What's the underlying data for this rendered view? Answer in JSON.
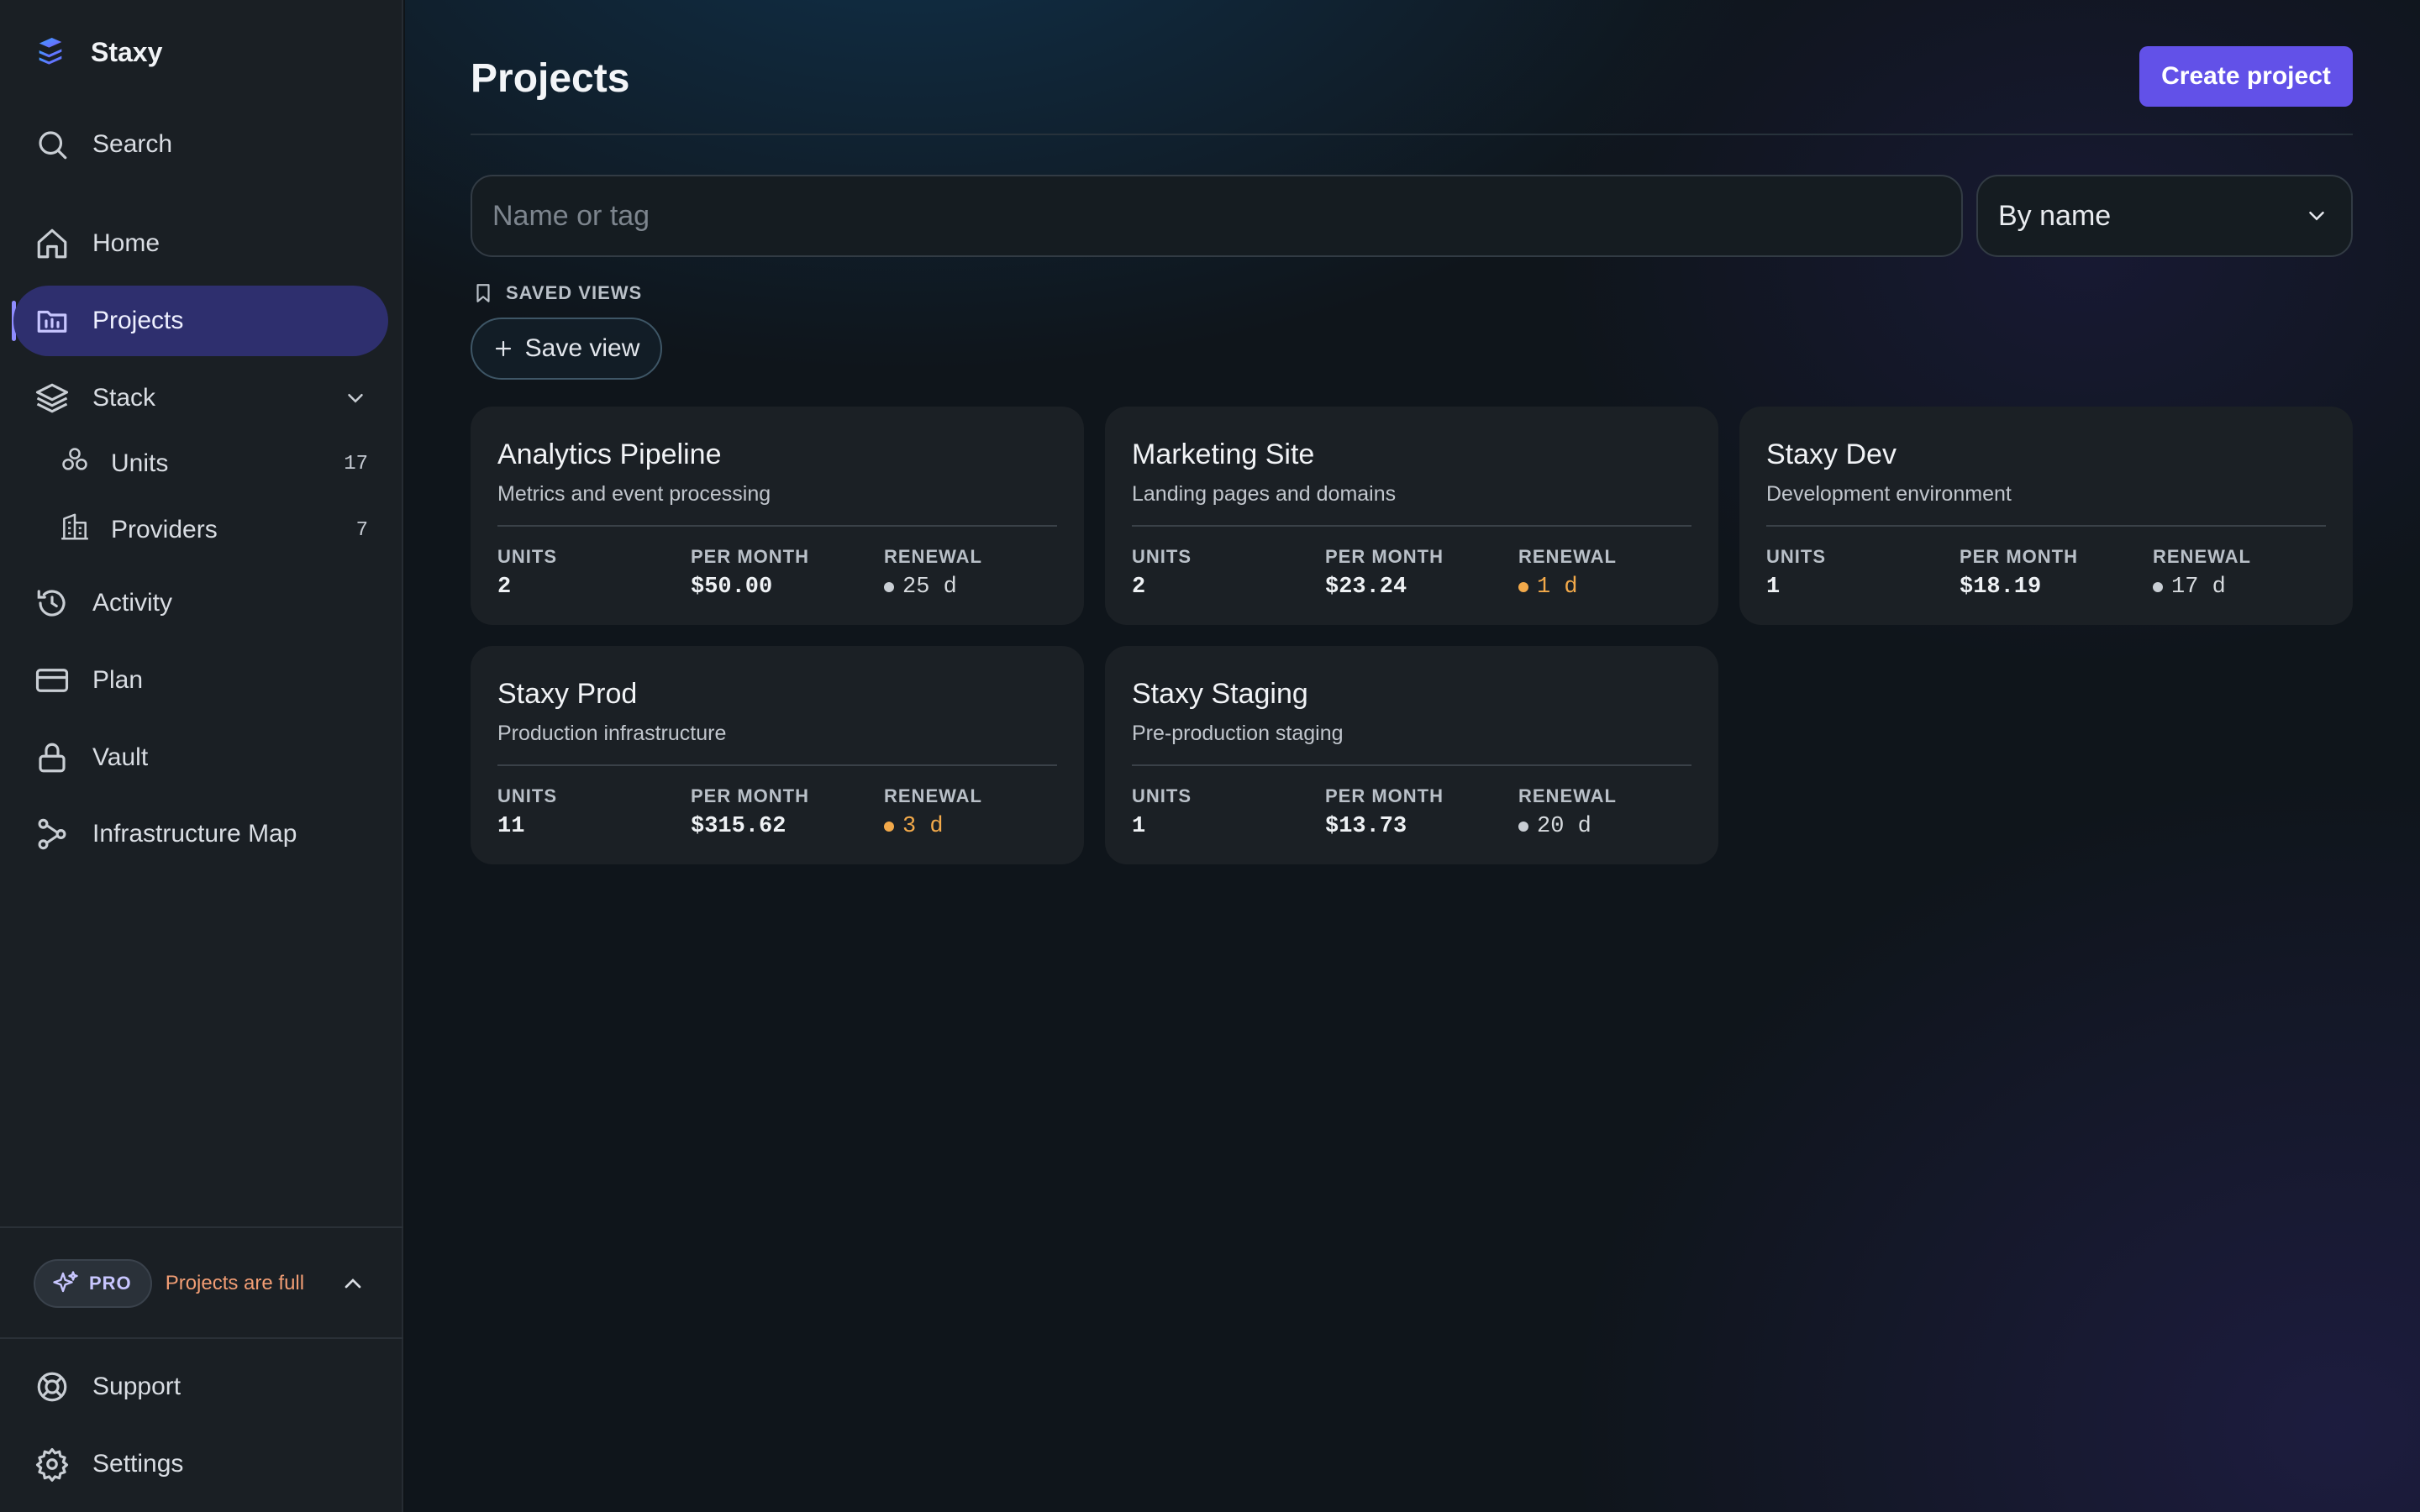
{
  "app": {
    "name": "Staxy"
  },
  "sidebar": {
    "search_label": "Search",
    "items": [
      {
        "label": "Home",
        "icon": "home-icon"
      },
      {
        "label": "Projects",
        "icon": "projects-icon"
      },
      {
        "label": "Stack",
        "icon": "layers-icon"
      },
      {
        "label": "Activity",
        "icon": "history-icon"
      },
      {
        "label": "Plan",
        "icon": "credit-card-icon"
      },
      {
        "label": "Vault",
        "icon": "lock-icon"
      },
      {
        "label": "Infrastructure Map",
        "icon": "route-icon"
      }
    ],
    "stack_children": [
      {
        "label": "Units",
        "count": "17",
        "icon": "boxes-icon"
      },
      {
        "label": "Providers",
        "count": "7",
        "icon": "building-icon"
      }
    ],
    "pro": {
      "badge": "PRO",
      "message": "Projects are full"
    },
    "bottom": [
      {
        "label": "Support",
        "icon": "lifebuoy-icon"
      },
      {
        "label": "Settings",
        "icon": "gear-icon"
      }
    ]
  },
  "main": {
    "title": "Projects",
    "create_button": "Create project",
    "search": {
      "placeholder": "Name or tag",
      "value": ""
    },
    "sort": {
      "selected": "By name"
    },
    "saved_views_label": "SAVED VIEWS",
    "save_view_button": "Save view",
    "stat_labels": {
      "units": "UNITS",
      "per_month": "PER MONTH",
      "renewal": "RENEWAL"
    },
    "projects": [
      {
        "name": "Analytics Pipeline",
        "description": "Metrics and event processing",
        "units": "2",
        "per_month": "$50.00",
        "renewal": "25 d",
        "renewal_status": "normal"
      },
      {
        "name": "Marketing Site",
        "description": "Landing pages and domains",
        "units": "2",
        "per_month": "$23.24",
        "renewal": "1 d",
        "renewal_status": "warning"
      },
      {
        "name": "Staxy Dev",
        "description": "Development environment",
        "units": "1",
        "per_month": "$18.19",
        "renewal": "17 d",
        "renewal_status": "normal"
      },
      {
        "name": "Staxy Prod",
        "description": "Production infrastructure",
        "units": "11",
        "per_month": "$315.62",
        "renewal": "3 d",
        "renewal_status": "warning"
      },
      {
        "name": "Staxy Staging",
        "description": "Pre-production staging",
        "units": "1",
        "per_month": "$13.73",
        "renewal": "20 d",
        "renewal_status": "normal"
      }
    ]
  },
  "colors": {
    "accent": "#6251e8",
    "active_nav": "#2e2f6e",
    "warning": "#f2a94a",
    "normal_dot": "#c9ced4",
    "pro_text": "#f19d74"
  }
}
